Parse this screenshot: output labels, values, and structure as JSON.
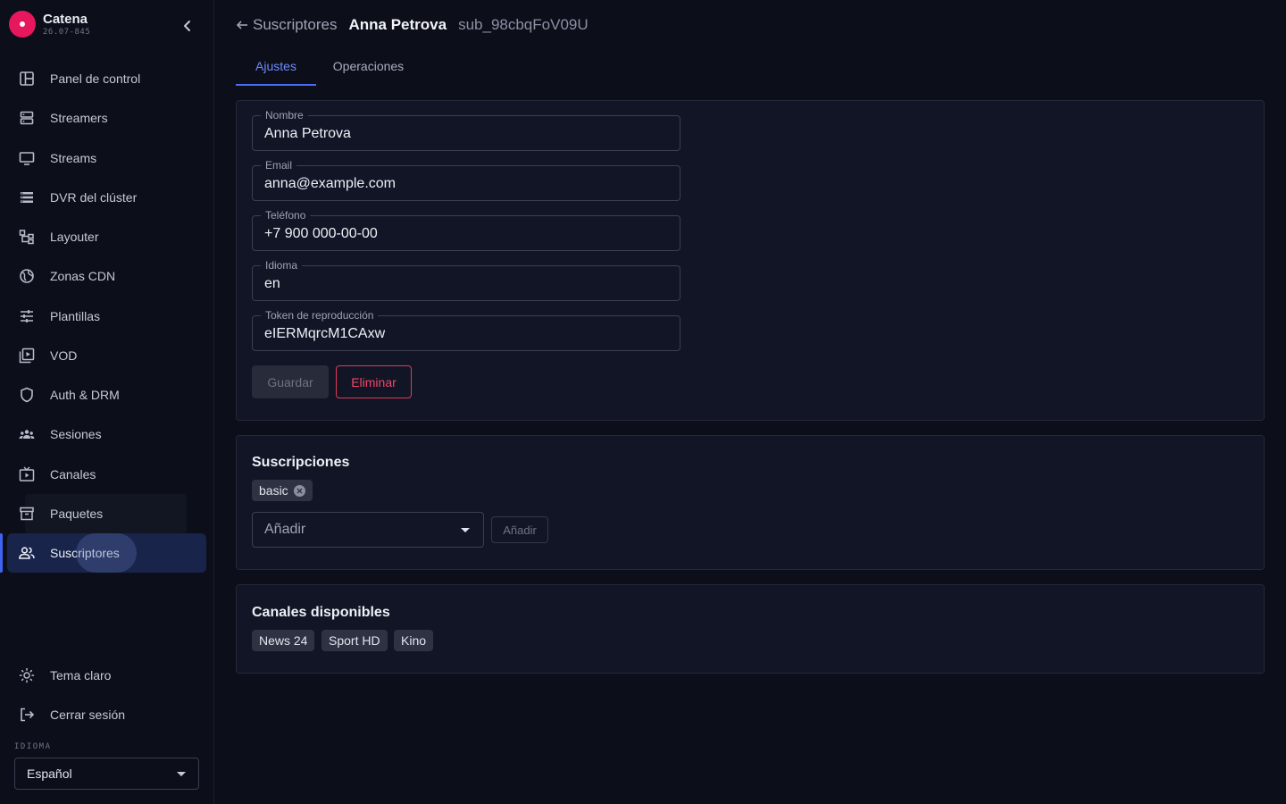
{
  "app": {
    "name": "Catena",
    "version": "26.07-845"
  },
  "sidebar": {
    "items": [
      {
        "label": "Panel de control",
        "icon": "dashboard-icon"
      },
      {
        "label": "Streamers",
        "icon": "server-icon"
      },
      {
        "label": "Streams",
        "icon": "monitor-icon"
      },
      {
        "label": "DVR del clúster",
        "icon": "storage-list-icon"
      },
      {
        "label": "Layouter",
        "icon": "layout-tree-icon"
      },
      {
        "label": "Zonas CDN",
        "icon": "globe-icon"
      },
      {
        "label": "Plantillas",
        "icon": "sliders-icon"
      },
      {
        "label": "VOD",
        "icon": "video-library-icon"
      },
      {
        "label": "Auth & DRM",
        "icon": "shield-icon"
      },
      {
        "label": "Sesiones",
        "icon": "users-group-icon"
      },
      {
        "label": "Canales",
        "icon": "tv-play-icon"
      },
      {
        "label": "Paquetes",
        "icon": "archive-box-icon"
      },
      {
        "label": "Suscriptores",
        "icon": "people-icon",
        "active": true
      }
    ],
    "bottom": {
      "theme_label": "Tema claro",
      "logout_label": "Cerrar sesión"
    },
    "language": {
      "label": "IDIOMA",
      "selected": "Español"
    }
  },
  "breadcrumb": {
    "parent": "Suscriptores",
    "name": "Anna Petrova",
    "id": "sub_98cbqFoV09U"
  },
  "tabs": [
    {
      "label": "Ajustes",
      "active": true
    },
    {
      "label": "Operaciones",
      "active": false
    }
  ],
  "form": {
    "fields": [
      {
        "label": "Nombre",
        "value": "Anna Petrova"
      },
      {
        "label": "Email",
        "value": "anna@example.com"
      },
      {
        "label": "Teléfono",
        "value": "+7 900 000-00-00"
      },
      {
        "label": "Idioma",
        "value": "en"
      },
      {
        "label": "Token de reproducción",
        "value": "eIERMqrcM1CAxw"
      }
    ],
    "save_label": "Guardar",
    "delete_label": "Eliminar"
  },
  "subscriptions": {
    "title": "Suscripciones",
    "chips": [
      "basic"
    ],
    "add_placeholder": "Añadir",
    "add_button": "Añadir"
  },
  "channels": {
    "title": "Canales disponibles",
    "chips": [
      "News 24",
      "Sport HD",
      "Kino"
    ]
  },
  "colors": {
    "accent": "#4b6bf5",
    "danger": "#f0476a",
    "brand": "#e6175c",
    "background": "#0c0e1a",
    "card": "#111525"
  }
}
